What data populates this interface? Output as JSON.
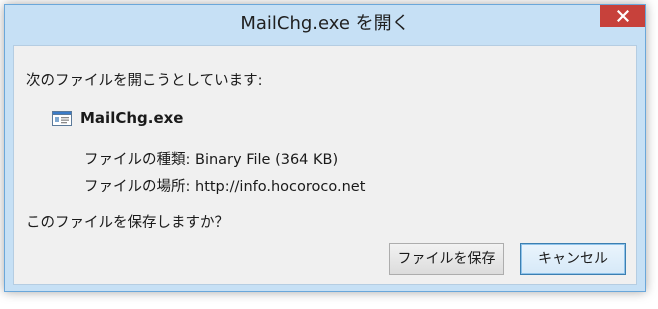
{
  "window": {
    "title": "MailChg.exe を開く",
    "close_icon": "close-icon"
  },
  "dialog": {
    "open_message": "次のファイルを開こうとしています:",
    "file_icon": "file-icon",
    "file_name": "MailChg.exe",
    "type_label": "ファイルの種類:",
    "type_value": "Binary File (364 KB)",
    "from_label": "ファイルの場所:",
    "from_value": "http://info.hocoroco.net",
    "question": "このファイルを保存しますか？"
  },
  "buttons": {
    "save_label": "ファイルを保存",
    "cancel_label": "キャンセル"
  },
  "colors": {
    "frame": "#c6e0f5",
    "close_button": "#c7413b",
    "client_background": "#f0f0f0",
    "default_button_border": "#3c7fb1"
  }
}
